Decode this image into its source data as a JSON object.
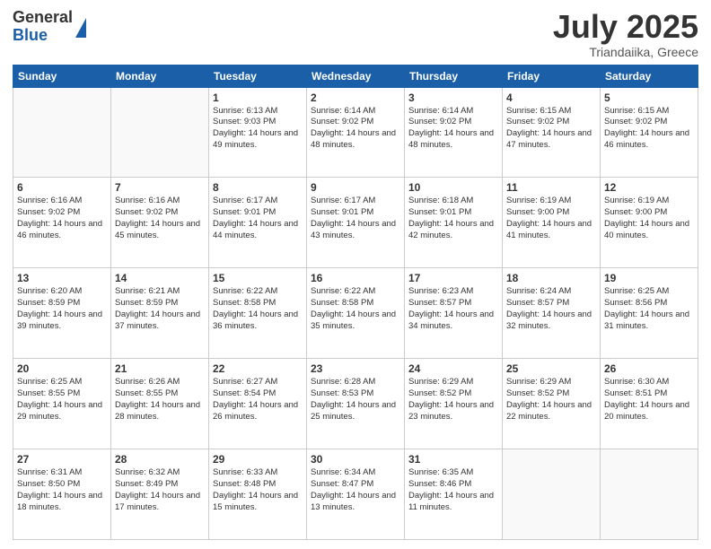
{
  "logo": {
    "general": "General",
    "blue": "Blue"
  },
  "header": {
    "month_year": "July 2025",
    "location": "Triandaiika, Greece"
  },
  "weekdays": [
    "Sunday",
    "Monday",
    "Tuesday",
    "Wednesday",
    "Thursday",
    "Friday",
    "Saturday"
  ],
  "weeks": [
    [
      {
        "day": "",
        "sunrise": "",
        "sunset": "",
        "daylight": ""
      },
      {
        "day": "",
        "sunrise": "",
        "sunset": "",
        "daylight": ""
      },
      {
        "day": "1",
        "sunrise": "Sunrise: 6:13 AM",
        "sunset": "Sunset: 9:03 PM",
        "daylight": "Daylight: 14 hours and 49 minutes."
      },
      {
        "day": "2",
        "sunrise": "Sunrise: 6:14 AM",
        "sunset": "Sunset: 9:02 PM",
        "daylight": "Daylight: 14 hours and 48 minutes."
      },
      {
        "day": "3",
        "sunrise": "Sunrise: 6:14 AM",
        "sunset": "Sunset: 9:02 PM",
        "daylight": "Daylight: 14 hours and 48 minutes."
      },
      {
        "day": "4",
        "sunrise": "Sunrise: 6:15 AM",
        "sunset": "Sunset: 9:02 PM",
        "daylight": "Daylight: 14 hours and 47 minutes."
      },
      {
        "day": "5",
        "sunrise": "Sunrise: 6:15 AM",
        "sunset": "Sunset: 9:02 PM",
        "daylight": "Daylight: 14 hours and 46 minutes."
      }
    ],
    [
      {
        "day": "6",
        "sunrise": "Sunrise: 6:16 AM",
        "sunset": "Sunset: 9:02 PM",
        "daylight": "Daylight: 14 hours and 46 minutes."
      },
      {
        "day": "7",
        "sunrise": "Sunrise: 6:16 AM",
        "sunset": "Sunset: 9:02 PM",
        "daylight": "Daylight: 14 hours and 45 minutes."
      },
      {
        "day": "8",
        "sunrise": "Sunrise: 6:17 AM",
        "sunset": "Sunset: 9:01 PM",
        "daylight": "Daylight: 14 hours and 44 minutes."
      },
      {
        "day": "9",
        "sunrise": "Sunrise: 6:17 AM",
        "sunset": "Sunset: 9:01 PM",
        "daylight": "Daylight: 14 hours and 43 minutes."
      },
      {
        "day": "10",
        "sunrise": "Sunrise: 6:18 AM",
        "sunset": "Sunset: 9:01 PM",
        "daylight": "Daylight: 14 hours and 42 minutes."
      },
      {
        "day": "11",
        "sunrise": "Sunrise: 6:19 AM",
        "sunset": "Sunset: 9:00 PM",
        "daylight": "Daylight: 14 hours and 41 minutes."
      },
      {
        "day": "12",
        "sunrise": "Sunrise: 6:19 AM",
        "sunset": "Sunset: 9:00 PM",
        "daylight": "Daylight: 14 hours and 40 minutes."
      }
    ],
    [
      {
        "day": "13",
        "sunrise": "Sunrise: 6:20 AM",
        "sunset": "Sunset: 8:59 PM",
        "daylight": "Daylight: 14 hours and 39 minutes."
      },
      {
        "day": "14",
        "sunrise": "Sunrise: 6:21 AM",
        "sunset": "Sunset: 8:59 PM",
        "daylight": "Daylight: 14 hours and 37 minutes."
      },
      {
        "day": "15",
        "sunrise": "Sunrise: 6:22 AM",
        "sunset": "Sunset: 8:58 PM",
        "daylight": "Daylight: 14 hours and 36 minutes."
      },
      {
        "day": "16",
        "sunrise": "Sunrise: 6:22 AM",
        "sunset": "Sunset: 8:58 PM",
        "daylight": "Daylight: 14 hours and 35 minutes."
      },
      {
        "day": "17",
        "sunrise": "Sunrise: 6:23 AM",
        "sunset": "Sunset: 8:57 PM",
        "daylight": "Daylight: 14 hours and 34 minutes."
      },
      {
        "day": "18",
        "sunrise": "Sunrise: 6:24 AM",
        "sunset": "Sunset: 8:57 PM",
        "daylight": "Daylight: 14 hours and 32 minutes."
      },
      {
        "day": "19",
        "sunrise": "Sunrise: 6:25 AM",
        "sunset": "Sunset: 8:56 PM",
        "daylight": "Daylight: 14 hours and 31 minutes."
      }
    ],
    [
      {
        "day": "20",
        "sunrise": "Sunrise: 6:25 AM",
        "sunset": "Sunset: 8:55 PM",
        "daylight": "Daylight: 14 hours and 29 minutes."
      },
      {
        "day": "21",
        "sunrise": "Sunrise: 6:26 AM",
        "sunset": "Sunset: 8:55 PM",
        "daylight": "Daylight: 14 hours and 28 minutes."
      },
      {
        "day": "22",
        "sunrise": "Sunrise: 6:27 AM",
        "sunset": "Sunset: 8:54 PM",
        "daylight": "Daylight: 14 hours and 26 minutes."
      },
      {
        "day": "23",
        "sunrise": "Sunrise: 6:28 AM",
        "sunset": "Sunset: 8:53 PM",
        "daylight": "Daylight: 14 hours and 25 minutes."
      },
      {
        "day": "24",
        "sunrise": "Sunrise: 6:29 AM",
        "sunset": "Sunset: 8:52 PM",
        "daylight": "Daylight: 14 hours and 23 minutes."
      },
      {
        "day": "25",
        "sunrise": "Sunrise: 6:29 AM",
        "sunset": "Sunset: 8:52 PM",
        "daylight": "Daylight: 14 hours and 22 minutes."
      },
      {
        "day": "26",
        "sunrise": "Sunrise: 6:30 AM",
        "sunset": "Sunset: 8:51 PM",
        "daylight": "Daylight: 14 hours and 20 minutes."
      }
    ],
    [
      {
        "day": "27",
        "sunrise": "Sunrise: 6:31 AM",
        "sunset": "Sunset: 8:50 PM",
        "daylight": "Daylight: 14 hours and 18 minutes."
      },
      {
        "day": "28",
        "sunrise": "Sunrise: 6:32 AM",
        "sunset": "Sunset: 8:49 PM",
        "daylight": "Daylight: 14 hours and 17 minutes."
      },
      {
        "day": "29",
        "sunrise": "Sunrise: 6:33 AM",
        "sunset": "Sunset: 8:48 PM",
        "daylight": "Daylight: 14 hours and 15 minutes."
      },
      {
        "day": "30",
        "sunrise": "Sunrise: 6:34 AM",
        "sunset": "Sunset: 8:47 PM",
        "daylight": "Daylight: 14 hours and 13 minutes."
      },
      {
        "day": "31",
        "sunrise": "Sunrise: 6:35 AM",
        "sunset": "Sunset: 8:46 PM",
        "daylight": "Daylight: 14 hours and 11 minutes."
      },
      {
        "day": "",
        "sunrise": "",
        "sunset": "",
        "daylight": ""
      },
      {
        "day": "",
        "sunrise": "",
        "sunset": "",
        "daylight": ""
      }
    ]
  ]
}
